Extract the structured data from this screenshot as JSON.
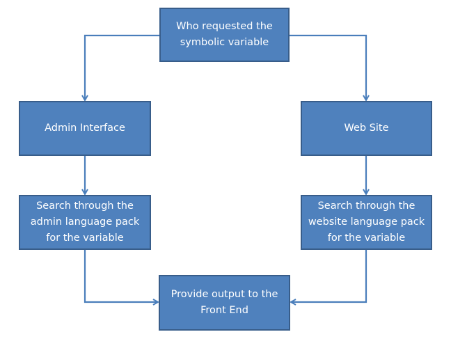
{
  "diagram": {
    "type": "flowchart",
    "colors": {
      "node_fill": "#4f81bd",
      "node_border": "#385d8a",
      "node_text": "#ffffff",
      "connector": "#4a7ebb"
    },
    "nodes": {
      "top": {
        "label": "Who requested the\nsymbolic variable"
      },
      "admin": {
        "label": "Admin  Interface"
      },
      "web": {
        "label": "Web  Site"
      },
      "search_admin": {
        "label": "Search through the\nadmin language pack\nfor the variable"
      },
      "search_web": {
        "label": "Search through the\nwebsite language  pack\nfor the variable"
      },
      "output": {
        "label": "Provide output  to the\nFront End"
      }
    },
    "edges": [
      {
        "from": "top",
        "to": "admin"
      },
      {
        "from": "top",
        "to": "web"
      },
      {
        "from": "admin",
        "to": "search_admin"
      },
      {
        "from": "web",
        "to": "search_web"
      },
      {
        "from": "search_admin",
        "to": "output"
      },
      {
        "from": "search_web",
        "to": "output"
      }
    ]
  }
}
